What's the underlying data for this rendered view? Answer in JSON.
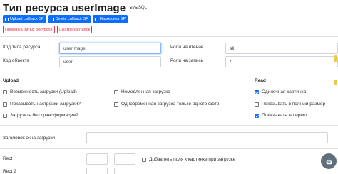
{
  "header": {
    "title": "Тип ресурса userImage",
    "sql_label": "SQL",
    "sql_code": "</>"
  },
  "toolbar": {
    "primary_buttons": [
      "Upload callback SP",
      "Delete callback SP",
      "HasAccess SP"
    ],
    "outline_buttons": [
      "Проверка битых ресурсов",
      "Сжатие картинок"
    ]
  },
  "form": {
    "resource_type_code_label": "Код типа ресурса",
    "resource_type_code_value": "userImage",
    "object_code_label": "Код объекта",
    "object_code_value": "user",
    "read_roles_label": "Роли на чтение",
    "read_roles_value": "all",
    "write_roles_label": "Роли на запись",
    "write_roles_value": "*"
  },
  "upload": {
    "title": "Upload",
    "options": [
      {
        "label": "Возможность загрузки (Upload)",
        "checked": false
      },
      {
        "label": "Показывать настройки загрузки?",
        "checked": false
      },
      {
        "label": "Загрузить без трансформации?",
        "checked": false
      }
    ],
    "options_middle": [
      {
        "label": "Немедленная загрузка",
        "checked": false
      },
      {
        "label": "Одновременная загрузка только одного фото",
        "checked": false
      }
    ]
  },
  "read": {
    "title": "Read",
    "options": [
      {
        "label": "Одиночная картинка",
        "checked": true
      },
      {
        "label": "Показывать в полный размер",
        "checked": false
      },
      {
        "label": "Показывать галерею",
        "checked": true
      }
    ]
  },
  "upload_window": {
    "title_label": "Заголовок окна загрузки",
    "title_value": ""
  },
  "rects": {
    "rect_label": "Rect",
    "rect2_label": "Rect 2",
    "add_fields_label": "Добавлять поля к картинке при загрузке",
    "add_fields_checked": false
  },
  "colors": {
    "primary": "#0d6efd",
    "danger": "#dc3545",
    "fab": "#5f6f7c"
  }
}
